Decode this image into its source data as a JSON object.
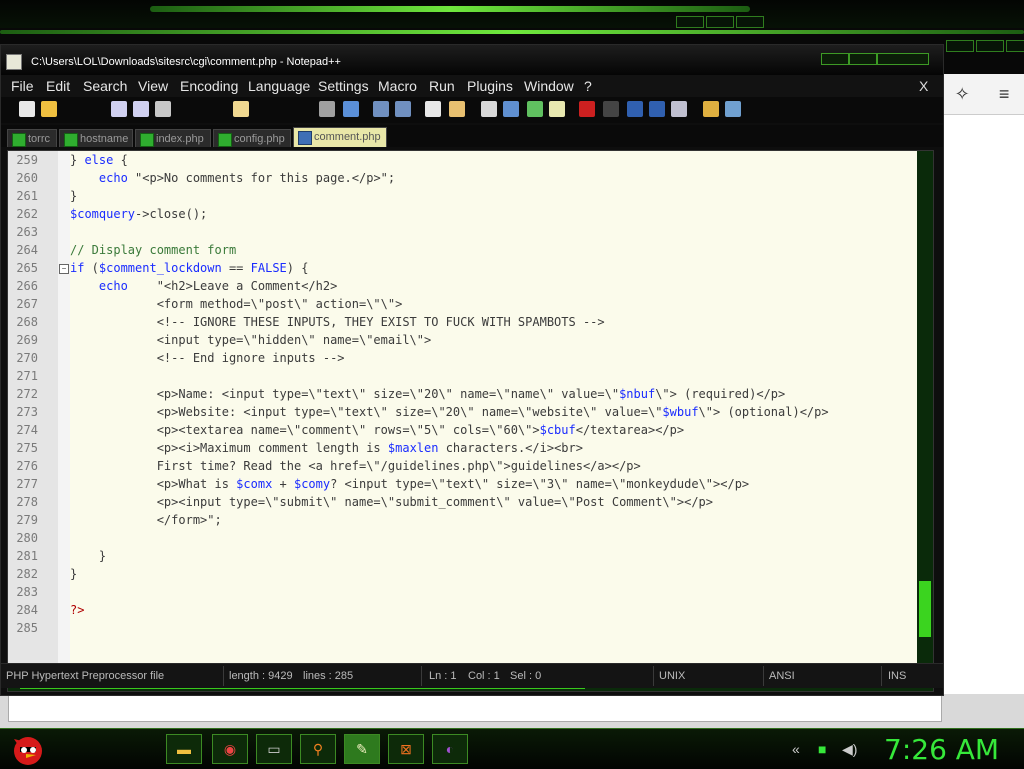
{
  "window": {
    "title": "C:\\Users\\LOL\\Downloads\\sitesrc\\cgi\\comment.php - Notepad++"
  },
  "menu": [
    "File",
    "Edit",
    "Search",
    "View",
    "Encoding",
    "Language",
    "Settings",
    "Macro",
    "Run",
    "Plugins",
    "Window",
    "?"
  ],
  "menu_close": "X",
  "tabs": [
    {
      "label": "torrc",
      "active": false
    },
    {
      "label": "hostname",
      "active": false
    },
    {
      "label": "index.php",
      "active": false
    },
    {
      "label": "config.php",
      "active": false
    },
    {
      "label": "comment.php",
      "active": true
    }
  ],
  "editor": {
    "lines": [
      {
        "n": "259",
        "text": "} else {"
      },
      {
        "n": "260",
        "text": "    echo \"<p>No comments for this page.</p>\";"
      },
      {
        "n": "261",
        "text": "}"
      },
      {
        "n": "262",
        "text": "$comquery->close();"
      },
      {
        "n": "263",
        "text": ""
      },
      {
        "n": "264",
        "text": "// Display comment form"
      },
      {
        "n": "265",
        "text": "if ($comment_lockdown == FALSE) {"
      },
      {
        "n": "266",
        "text": "    echo    \"<h2>Leave a Comment</h2>"
      },
      {
        "n": "267",
        "text": "            <form method=\\\"post\\\" action=\\\"\\\">"
      },
      {
        "n": "268",
        "text": "            <!-- IGNORE THESE INPUTS, THEY EXIST TO FUCK WITH SPAMBOTS -->"
      },
      {
        "n": "269",
        "text": "            <input type=\\\"hidden\\\" name=\\\"email\\\">"
      },
      {
        "n": "270",
        "text": "            <!-- End ignore inputs -->"
      },
      {
        "n": "271",
        "text": ""
      },
      {
        "n": "272",
        "text": "            <p>Name: <input type=\\\"text\\\" size=\\\"20\\\" name=\\\"name\\\" value=\\\"$nbuf\\\"> (required)</p>"
      },
      {
        "n": "273",
        "text": "            <p>Website: <input type=\\\"text\\\" size=\\\"20\\\" name=\\\"website\\\" value=\\\"$wbuf\\\"> (optional)</p>"
      },
      {
        "n": "274",
        "text": "            <p><textarea name=\\\"comment\\\" rows=\\\"5\\\" cols=\\\"60\\\">$cbuf</textarea></p>"
      },
      {
        "n": "275",
        "text": "            <p><i>Maximum comment length is $maxlen characters.</i><br>"
      },
      {
        "n": "276",
        "text": "            First time? Read the <a href=\\\"/guidelines.php\\\">guidelines</a></p>"
      },
      {
        "n": "277",
        "text": "            <p>What is $comx + $comy? <input type=\\\"text\\\" size=\\\"3\\\" name=\\\"monkeydude\\\"></p>"
      },
      {
        "n": "278",
        "text": "            <p><input type=\\\"submit\\\" name=\\\"submit_comment\\\" value=\\\"Post Comment\\\"></p>"
      },
      {
        "n": "279",
        "text": "            </form>\";"
      },
      {
        "n": "280",
        "text": ""
      },
      {
        "n": "281",
        "text": "    }"
      },
      {
        "n": "282",
        "text": "}"
      },
      {
        "n": "283",
        "text": ""
      },
      {
        "n": "284",
        "text": "?>"
      },
      {
        "n": "285",
        "text": ""
      }
    ]
  },
  "status": {
    "filetype": "PHP Hypertext Preprocessor file",
    "length": "length : 9429",
    "lines": "lines : 285",
    "ln": "Ln : 1",
    "col": "Col : 1",
    "sel": "Sel : 0",
    "eol": "UNIX",
    "encoding": "ANSI",
    "mode": "INS"
  },
  "taskbar": {
    "clock": "7:26 AM",
    "accent": "#36e83a"
  }
}
